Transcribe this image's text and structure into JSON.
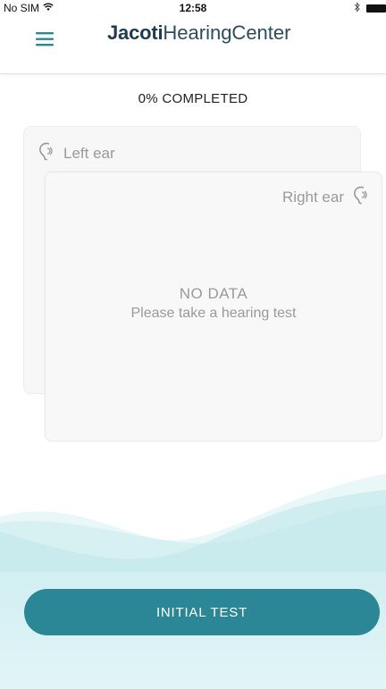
{
  "status_bar": {
    "carrier": "No SIM",
    "time": "12:58",
    "icons": [
      "wifi-icon",
      "bluetooth-icon",
      "battery-icon"
    ]
  },
  "nav": {
    "title_bold": "Jacoti",
    "title_light": "HearingCenter",
    "menu_icon": "hamburger-menu-icon"
  },
  "progress": {
    "label": "0% COMPLETED",
    "value": 0
  },
  "cards": {
    "left": {
      "label": "Left ear",
      "icon": "ear-icon"
    },
    "right": {
      "label": "Right ear",
      "icon": "ear-icon",
      "empty_title": "NO DATA",
      "empty_message": "Please take a hearing test"
    }
  },
  "cta": {
    "label": "INITIAL TEST"
  },
  "colors": {
    "accent": "#2b8796",
    "title_text": "#1f3b4d",
    "muted_text": "#9a9a9a",
    "wave_light": "#e6f6f7",
    "wave_mid": "#c9ebee",
    "wave_strong": "#a9dde3"
  }
}
